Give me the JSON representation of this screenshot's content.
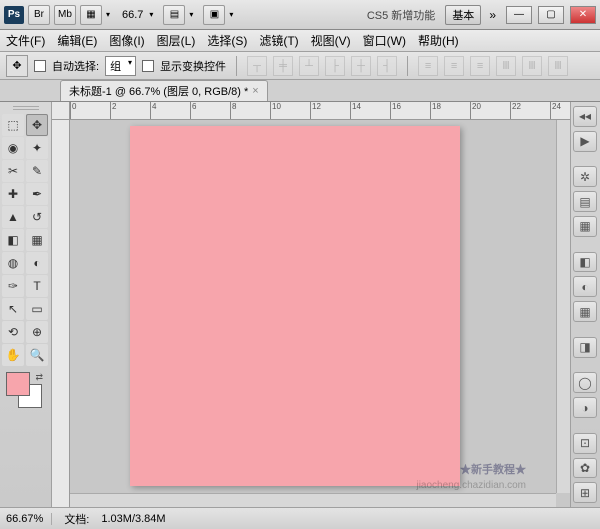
{
  "app": {
    "icon_text": "Ps"
  },
  "titlebar": {
    "bridge_label": "Br",
    "minibridge_label": "Mb",
    "zoom_value": "66.7",
    "workspace_new": "CS5 新增功能",
    "workspace_basic": "基本"
  },
  "menu": {
    "file": "文件(F)",
    "edit": "编辑(E)",
    "image": "图像(I)",
    "layer": "图层(L)",
    "select": "选择(S)",
    "filter": "滤镜(T)",
    "view": "视图(V)",
    "window": "窗口(W)",
    "help": "帮助(H)"
  },
  "options": {
    "auto_select_label": "自动选择:",
    "auto_select_mode": "组",
    "transform_controls_label": "显示变换控件"
  },
  "document": {
    "tab_title": "未标题-1 @ 66.7% (图层 0, RGB/8) *",
    "canvas_color": "#f7a5ac"
  },
  "ruler_marks": [
    "0",
    "2",
    "4",
    "6",
    "8",
    "10",
    "12",
    "14",
    "16",
    "18",
    "20",
    "22",
    "24"
  ],
  "swatches": {
    "foreground": "#f7a5ac",
    "background": "#ffffff"
  },
  "status": {
    "zoom": "66.67%",
    "doc_size_label": "文档:",
    "doc_size": "1.03M/3.84M"
  },
  "watermark": {
    "line1": "★新手教程★",
    "line2": "jiaocheng.chazidian.com"
  }
}
